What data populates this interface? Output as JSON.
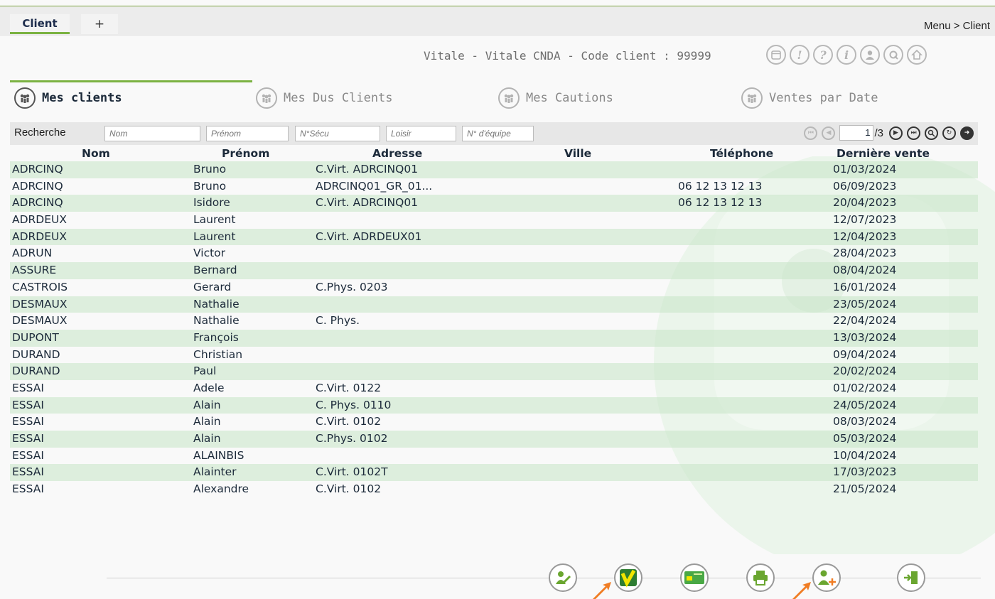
{
  "tabs": {
    "active": "Client",
    "add": "+"
  },
  "breadcrumb": "Menu > Client",
  "info": "Vitale - Vitale CNDA - Code client : 99999",
  "top_icons": [
    "calendar-icon",
    "warning-icon",
    "help-icon",
    "info-icon",
    "user-icon",
    "settings-icon",
    "home-icon"
  ],
  "sections": [
    {
      "label": "Mes clients",
      "active": true
    },
    {
      "label": "Mes Dus Clients",
      "active": false
    },
    {
      "label": "Mes Cautions",
      "active": false
    },
    {
      "label": "Ventes par Date",
      "active": false
    }
  ],
  "search": {
    "label": "Recherche",
    "placeholders": {
      "nom": "Nom",
      "prenom": "Prénom",
      "secu": "N°Sécu",
      "loisir": "Loisir",
      "equipe": "N° d'équipe"
    }
  },
  "pager": {
    "page": "1",
    "total": "/3"
  },
  "table": {
    "headers": {
      "nom": "Nom",
      "prenom": "Prénom",
      "adresse": "Adresse",
      "ville": "Ville",
      "telephone": "Téléphone",
      "derniere_vente": "Dernière vente"
    },
    "rows": [
      {
        "nom": "ADRCINQ",
        "prenom": "Bruno",
        "adresse": "C.Virt. ADRCINQ01",
        "ville": "",
        "telephone": "",
        "date": "01/03/2024"
      },
      {
        "nom": "ADRCINQ",
        "prenom": "Bruno",
        "adresse": "ADRCINQ01_GR_01...",
        "ville": "",
        "telephone": "06 12 13 12 13",
        "date": "06/09/2023"
      },
      {
        "nom": "ADRCINQ",
        "prenom": "Isidore",
        "adresse": "C.Virt. ADRCINQ01",
        "ville": "",
        "telephone": "06 12 13 12 13",
        "date": "20/04/2023"
      },
      {
        "nom": "ADRDEUX",
        "prenom": "Laurent",
        "adresse": "",
        "ville": "",
        "telephone": "",
        "date": "12/07/2023"
      },
      {
        "nom": "ADRDEUX",
        "prenom": "Laurent",
        "adresse": "C.Virt. ADRDEUX01",
        "ville": "",
        "telephone": "",
        "date": "12/04/2023"
      },
      {
        "nom": "ADRUN",
        "prenom": "Victor",
        "adresse": "",
        "ville": "",
        "telephone": "",
        "date": "28/04/2023"
      },
      {
        "nom": "ASSURE",
        "prenom": "Bernard",
        "adresse": "",
        "ville": "",
        "telephone": "",
        "date": "08/04/2024"
      },
      {
        "nom": "CASTROIS",
        "prenom": "Gerard",
        "adresse": "C.Phys. 0203",
        "ville": "",
        "telephone": "",
        "date": "16/01/2024"
      },
      {
        "nom": "DESMAUX",
        "prenom": "Nathalie",
        "adresse": "",
        "ville": "",
        "telephone": "",
        "date": "23/05/2024"
      },
      {
        "nom": "DESMAUX",
        "prenom": "Nathalie",
        "adresse": "C. Phys.",
        "ville": "",
        "telephone": "",
        "date": "22/04/2024"
      },
      {
        "nom": "DUPONT",
        "prenom": "François",
        "adresse": "",
        "ville": "",
        "telephone": "",
        "date": "13/03/2024"
      },
      {
        "nom": "DURAND",
        "prenom": "Christian",
        "adresse": "",
        "ville": "",
        "telephone": "",
        "date": "09/04/2024"
      },
      {
        "nom": "DURAND",
        "prenom": "Paul",
        "adresse": "",
        "ville": "",
        "telephone": "",
        "date": "20/02/2024"
      },
      {
        "nom": "ESSAI",
        "prenom": "Adele",
        "adresse": "C.Virt. 0122",
        "ville": "",
        "telephone": "",
        "date": "01/02/2024"
      },
      {
        "nom": "ESSAI",
        "prenom": "Alain",
        "adresse": "C. Phys. 0110",
        "ville": "",
        "telephone": "",
        "date": "24/05/2024"
      },
      {
        "nom": "ESSAI",
        "prenom": "Alain",
        "adresse": "C.Virt. 0102",
        "ville": "",
        "telephone": "",
        "date": "08/03/2024"
      },
      {
        "nom": "ESSAI",
        "prenom": "Alain",
        "adresse": "C.Phys. 0102",
        "ville": "",
        "telephone": "",
        "date": "05/03/2024"
      },
      {
        "nom": "ESSAI",
        "prenom": "ALAINBIS",
        "adresse": "",
        "ville": "",
        "telephone": "",
        "date": "10/04/2024"
      },
      {
        "nom": "ESSAI",
        "prenom": "Alainter",
        "adresse": "C.Virt. 0102T",
        "ville": "",
        "telephone": "",
        "date": "17/03/2023"
      },
      {
        "nom": "ESSAI",
        "prenom": "Alexandre",
        "adresse": "C.Virt. 0102",
        "ville": "",
        "telephone": "",
        "date": "21/05/2024"
      }
    ]
  },
  "actions": [
    "edit-client-icon",
    "vitale-check-icon",
    "vitale-card-icon",
    "print-icon",
    "add-client-icon",
    "exit-icon"
  ],
  "colors": {
    "accent": "#7bb242",
    "row_alt": "#c9e6c9",
    "arrow": "#f07d24"
  }
}
